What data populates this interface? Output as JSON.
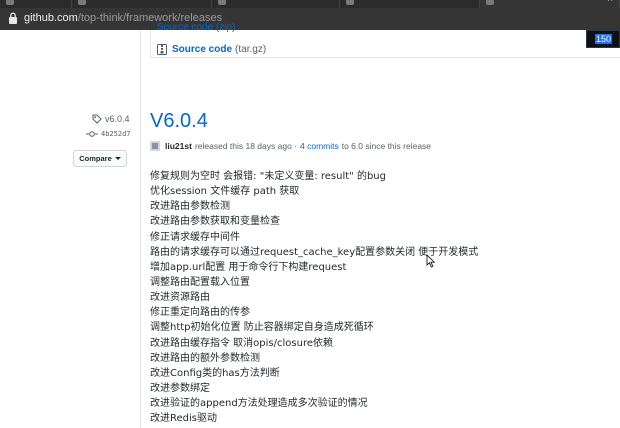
{
  "browser": {
    "tabs": [
      {
        "label": ""
      },
      {
        "label": ""
      },
      {
        "label": ""
      },
      {
        "label": ""
      },
      {
        "label": ""
      }
    ],
    "url_domain": "github.com",
    "url_path": "/top-think/framework/releases"
  },
  "assets": {
    "top_partial": "Source code (zip)",
    "source_tar_label": "Source code",
    "source_tar_ext": "(tar.gz)"
  },
  "badge": {
    "value": "150"
  },
  "sidebar": {
    "tag": "v6.0.4",
    "commit": "4b252d7",
    "compare_label": "Compare"
  },
  "release": {
    "title": "V6.0.4",
    "author": "liu21st",
    "released_text": "released this 18 days ago ·",
    "commits_link": "4 commits",
    "since_text": "to 6.0 since this release",
    "notes": [
      "修复规则为空时 会报错: \"未定义变量: result\" 的bug",
      "优化session 文件缓存 path 获取",
      "改进路由参数检测",
      "改进路由参数获取和变量检查",
      "修正请求缓存中间件",
      "路由的请求缓存可以通过request_cache_key配置参数关闭 便于开发模式",
      "增加app.url配置 用于命令行下构建request",
      "调整路由配置载入位置",
      "改进资源路由",
      "修正重定向路由的传参",
      "调整http初始化位置 防止容器绑定自身造成死循环",
      "改进路由缓存指令 取消opis/closure依赖",
      "改进路由的额外参数检测",
      "改进Config类的has方法判断",
      "改进参数绑定",
      "改进验证的append方法处理造成多次验证的情况",
      "改进Redis驱动"
    ]
  }
}
